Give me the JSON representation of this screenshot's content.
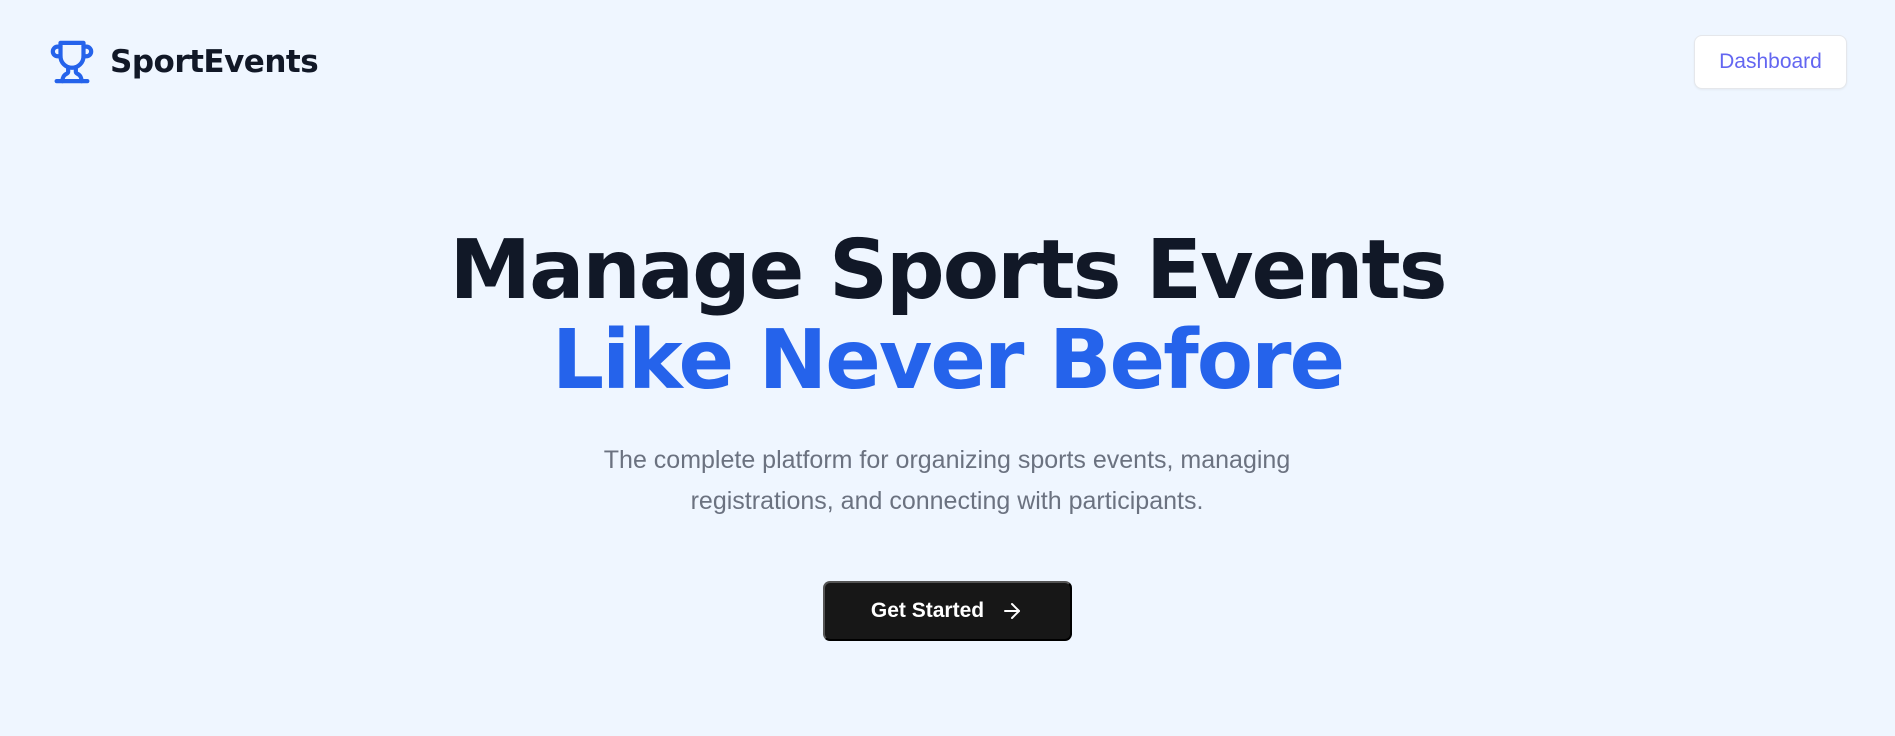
{
  "header": {
    "brand": {
      "icon": "trophy-icon",
      "name": "SportEvents",
      "color": "#2563eb"
    },
    "dashboard_label": "Dashboard"
  },
  "hero": {
    "headline_line1": "Manage Sports Events",
    "headline_line2": "Like Never Before",
    "subtitle_line1": "The complete platform for organizing sports events, managing",
    "subtitle_line2": "registrations, and connecting with participants.",
    "cta": {
      "label": "Get Started",
      "icon": "arrow-right-icon"
    }
  },
  "colors": {
    "background": "#eff6ff",
    "accent": "#2563eb",
    "text_dark": "#111827",
    "text_muted": "#6b7280",
    "button_dark": "#171717",
    "link_indigo": "#6366f1"
  }
}
